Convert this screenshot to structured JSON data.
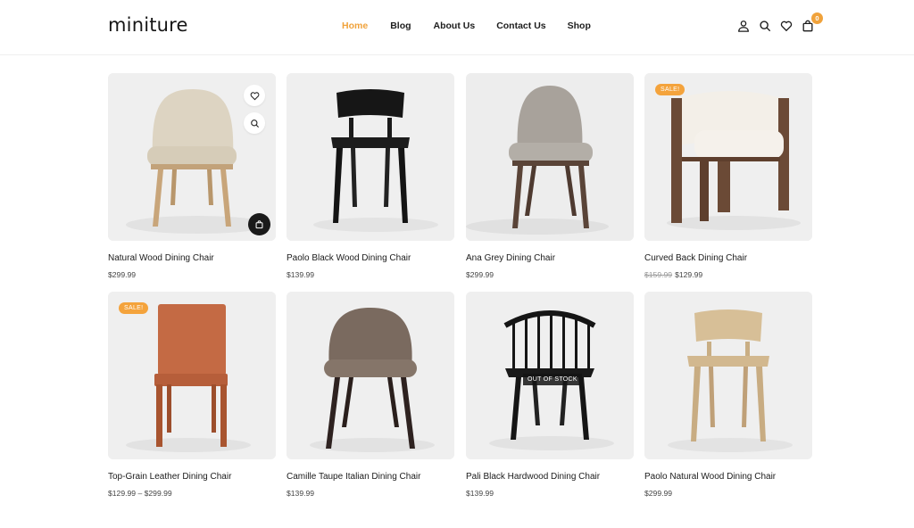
{
  "brand": {
    "logo": "miniture"
  },
  "nav": {
    "items": [
      {
        "label": "Home",
        "active": true
      },
      {
        "label": "Blog",
        "active": false
      },
      {
        "label": "About Us",
        "active": false
      },
      {
        "label": "Contact Us",
        "active": false
      },
      {
        "label": "Shop",
        "active": false
      }
    ]
  },
  "header_icons": [
    {
      "icon": "user-icon"
    },
    {
      "icon": "search-icon"
    },
    {
      "icon": "heart-icon"
    },
    {
      "icon": "cart-icon",
      "badge": "0"
    }
  ],
  "colors": {
    "accent": "#f0a23b",
    "sale_badge": "#f4a33c",
    "dark": "#1a1a1a"
  },
  "products": [
    {
      "title": "Natural Wood Dining Chair",
      "price": "$299.99",
      "old_price": null,
      "badge": null,
      "overlay": null,
      "icon": "chair-beige-fabric"
    },
    {
      "title": "Paolo Black Wood Dining Chair",
      "price": "$139.99",
      "old_price": null,
      "badge": null,
      "overlay": null,
      "icon": "chair-black-wood"
    },
    {
      "title": "Ana Grey Dining Chair",
      "price": "$299.99",
      "old_price": null,
      "badge": null,
      "overlay": null,
      "icon": "chair-grey-fabric"
    },
    {
      "title": "Curved Back Dining Chair",
      "price": "$129.99",
      "old_price": "$159.99",
      "badge": "SALE!",
      "overlay": null,
      "icon": "chair-curved-white"
    },
    {
      "title": "Top-Grain Leather Dining Chair",
      "price": "$129.99 – $299.99",
      "old_price": null,
      "badge": "SALE!",
      "overlay": null,
      "icon": "chair-leather-brown"
    },
    {
      "title": "Camille Taupe Italian Dining Chair",
      "price": "$139.99",
      "old_price": null,
      "badge": null,
      "overlay": null,
      "icon": "chair-taupe-fabric"
    },
    {
      "title": "Pali Black Hardwood Dining Chair",
      "price": "$139.99",
      "old_price": null,
      "badge": null,
      "overlay": "OUT OF STOCK",
      "icon": "chair-windsor-black"
    },
    {
      "title": "Paolo Natural Wood Dining Chair",
      "price": "$299.99",
      "old_price": null,
      "badge": null,
      "overlay": null,
      "icon": "chair-natural-wood"
    }
  ],
  "hover_card_actions": [
    {
      "icon": "heart-icon"
    },
    {
      "icon": "search-icon"
    },
    {
      "icon": "add-to-cart-icon"
    }
  ]
}
